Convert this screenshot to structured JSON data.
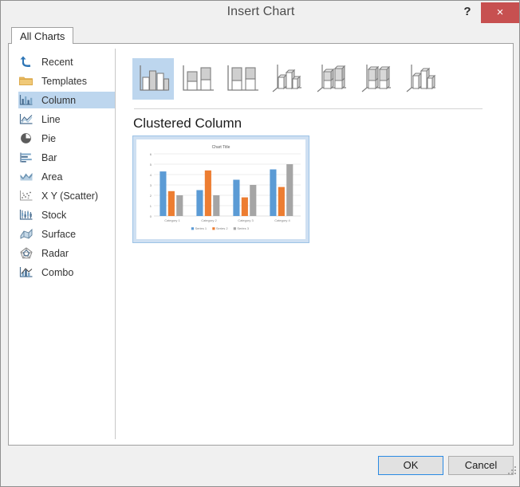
{
  "window": {
    "title": "Insert Chart",
    "help_label": "?",
    "close_label": "×"
  },
  "tabs": [
    {
      "label": "All Charts",
      "selected": true
    }
  ],
  "sidebar": {
    "items": [
      {
        "label": "Recent",
        "icon": "recent-undo-icon",
        "selected": false
      },
      {
        "label": "Templates",
        "icon": "folder-icon",
        "selected": false
      },
      {
        "label": "Column",
        "icon": "column-chart-icon",
        "selected": true
      },
      {
        "label": "Line",
        "icon": "line-chart-icon",
        "selected": false
      },
      {
        "label": "Pie",
        "icon": "pie-chart-icon",
        "selected": false
      },
      {
        "label": "Bar",
        "icon": "bar-chart-icon",
        "selected": false
      },
      {
        "label": "Area",
        "icon": "area-chart-icon",
        "selected": false
      },
      {
        "label": "X Y (Scatter)",
        "icon": "scatter-chart-icon",
        "selected": false
      },
      {
        "label": "Stock",
        "icon": "stock-chart-icon",
        "selected": false
      },
      {
        "label": "Surface",
        "icon": "surface-chart-icon",
        "selected": false
      },
      {
        "label": "Radar",
        "icon": "radar-chart-icon",
        "selected": false
      },
      {
        "label": "Combo",
        "icon": "combo-chart-icon",
        "selected": false
      }
    ]
  },
  "gallery": {
    "thumbnails": [
      {
        "name": "clustered-column",
        "selected": true
      },
      {
        "name": "stacked-column",
        "selected": false
      },
      {
        "name": "100-percent-stacked-column",
        "selected": false
      },
      {
        "name": "3d-clustered-column",
        "selected": false
      },
      {
        "name": "3d-stacked-column",
        "selected": false
      },
      {
        "name": "3d-100-percent-stacked-column",
        "selected": false
      },
      {
        "name": "3d-column",
        "selected": false
      }
    ]
  },
  "preview": {
    "heading": "Clustered Column"
  },
  "footer": {
    "ok_label": "OK",
    "cancel_label": "Cancel"
  },
  "colors": {
    "accent_selection": "#bdd6ee",
    "close_red": "#c75050",
    "series1": "#5b9bd5",
    "series2": "#ed7d31",
    "series3": "#a5a5a5",
    "ok_focus_border": "#2a8ae4"
  },
  "chart_data": {
    "type": "bar",
    "title": "Chart Title",
    "categories": [
      "Category 1",
      "Category 2",
      "Category 3",
      "Category 4"
    ],
    "series": [
      {
        "name": "Series 1",
        "color": "#5b9bd5",
        "values": [
          4.3,
          2.5,
          3.5,
          4.5
        ]
      },
      {
        "name": "Series 2",
        "color": "#ed7d31",
        "values": [
          2.4,
          4.4,
          1.8,
          2.8
        ]
      },
      {
        "name": "Series 3",
        "color": "#a5a5a5",
        "values": [
          2,
          2,
          3,
          5
        ]
      }
    ],
    "xlabel": "",
    "ylabel": "",
    "ylim": [
      0,
      6
    ],
    "yticks": [
      0,
      1,
      2,
      3,
      4,
      5,
      6
    ],
    "grid": true,
    "legend_position": "bottom"
  }
}
